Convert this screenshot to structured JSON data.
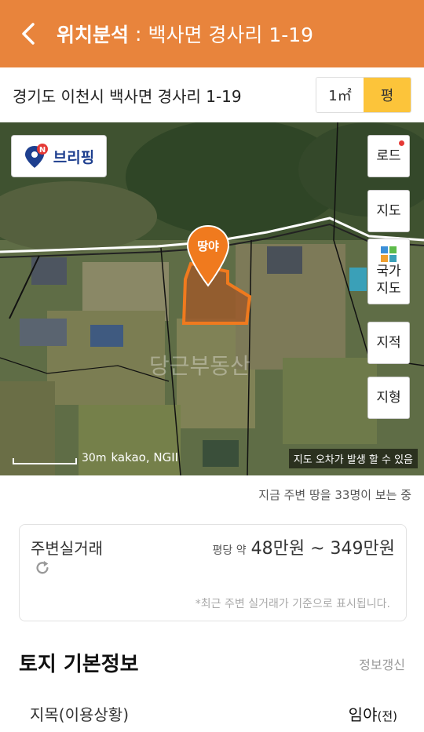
{
  "header": {
    "title": "위치분석",
    "colon": ":",
    "subtitle": "백사면 경사리 1-19"
  },
  "address_bar": {
    "address": "경기도 이천시 백사면 경사리 1-19",
    "units": [
      "1㎡",
      "평"
    ],
    "active_unit": "평"
  },
  "map": {
    "brand_label": "브리핑",
    "brand_badge_letter": "N",
    "pin_label": "땅야",
    "controls": {
      "road": "로드",
      "map": "지도",
      "national_map": "국가\n지도",
      "cadastral": "지적",
      "terrain": "지형"
    },
    "scale_label": "30m",
    "provider_label": "kakao, NGII",
    "error_note": "지도 오차가 발생 할 수 있음",
    "watermark": "당근부동산"
  },
  "viewing_text": "지금 주변 땅을 33명이 보는 중",
  "nearby_deals": {
    "label": "주변실거래",
    "price_prefix": "평당 약",
    "price_range": "48만원 ~ 349만원",
    "note": "*최근 주변 실거래가 기준으로 표시됩니다."
  },
  "land_info": {
    "title": "토지 기본정보",
    "refresh_label": "정보갱신",
    "rows": [
      {
        "label": "지목(이용상황)",
        "value": "임야",
        "value_suffix": "(전)"
      }
    ]
  },
  "colors": {
    "header_bg": "#e8843c",
    "active_unit_bg": "#fcc43a",
    "pin_orange": "#f07a1e",
    "brand_blue": "#1e3f8f"
  }
}
